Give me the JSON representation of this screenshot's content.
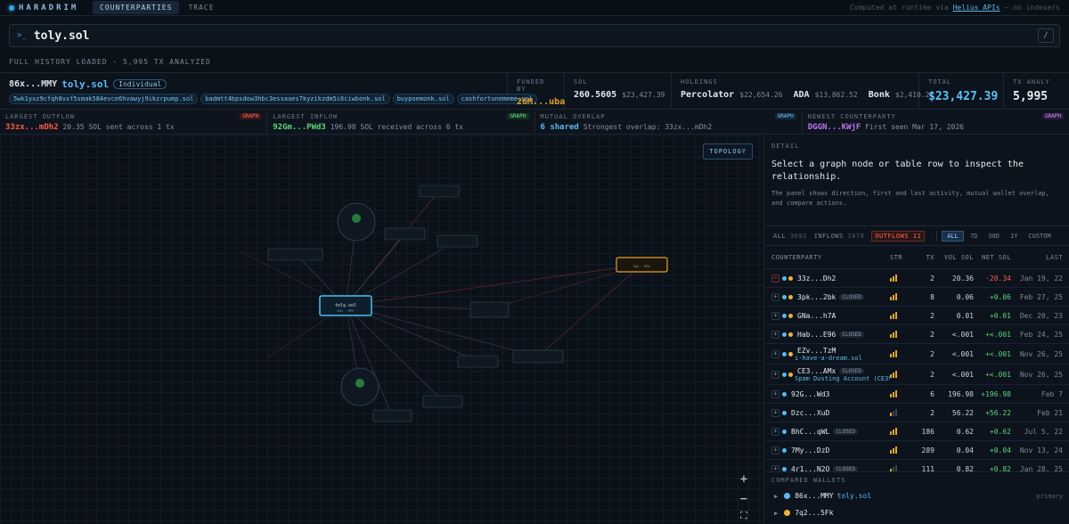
{
  "app": {
    "brand": "HARADRIM",
    "tabs": [
      "COUNTERPARTIES",
      "TRACE"
    ],
    "computed_prefix": "Computed at runtime via",
    "computed_link": "Helius APIs",
    "computed_suffix": "— no indexers"
  },
  "search": {
    "prompt": ">_",
    "query": "toly.sol",
    "shortcut": "/"
  },
  "status": "FULL HISTORY LOADED · 5,995 TX ANALYZED",
  "wallet": {
    "address": "86x...MMY",
    "name": "toly.sol",
    "type": "Individual",
    "domains": [
      "5wk1yxz9cfqh8vxf5smak584evce6hvawyj9ikzrpump.sol",
      "badmtt4bpsdow3hbc3essaaes7kyzikzdm5i6ciwbonk.sol",
      "buypoemonk.sol",
      "cashfortunememe.sol"
    ]
  },
  "summary": {
    "funded_by_label": "FUNDED BY",
    "funded_by": "26M...uba",
    "sol_label": "SOL",
    "sol": "260.5605",
    "sol_usd": "$23,427.39",
    "holdings_label": "HOLDINGS",
    "holdings": [
      {
        "name": "Percolator",
        "value": "$22,654.26"
      },
      {
        "name": "ADA",
        "value": "$13,862.52"
      },
      {
        "name": "Bonk",
        "value": "$2,410.27"
      }
    ],
    "total_label": "TOTAL",
    "total": "$23,427.39",
    "tx_label": "TX ANALYZE",
    "tx": "5,995"
  },
  "cards": [
    {
      "label": "LARGEST OUTFLOW",
      "tag": "GRAPH",
      "main": "33zx...mDh2",
      "text": "20.35 SOL sent across 1 tx"
    },
    {
      "label": "LARGEST INFLOW",
      "tag": "GRAPH",
      "main": "92Gm...PWd3",
      "text": "196.98 SOL received across 6 tx"
    },
    {
      "label": "MUTUAL OVERLAP",
      "tag": "GRAPH",
      "main": "6 shared",
      "text": "Strongest overlap: 33zx...mDh2"
    },
    {
      "label": "NEWEST COUNTERPARTY",
      "tag": "GRAPH",
      "main": "DGGN...KWjF",
      "text": "First seen Mar 17, 2026"
    }
  ],
  "graph": {
    "topology_label": "TOPOLOGY",
    "zoom_in": "+",
    "zoom_out": "−",
    "fit": "⛶",
    "center": {
      "title": "toly.sol",
      "sub": "86x...MMY"
    },
    "highlight": {
      "title": "7q2...5Fk"
    }
  },
  "detail": {
    "label": "DETAIL",
    "title": "Select a graph node or table row to inspect the relationship.",
    "desc": "The panel shows direction, first and last activity, mutual wallet overlap, and compare actions.",
    "filters": [
      {
        "label": "ALL",
        "count": "3092"
      },
      {
        "label": "INFLOWS",
        "count": "1879"
      },
      {
        "label": "OUTFLOWS",
        "count": "11"
      }
    ],
    "ranges": [
      "ALL",
      "7D",
      "30D",
      "1Y",
      "CUSTOM"
    ],
    "columns": [
      "COUNTERPARTY",
      "STR",
      "TX",
      "VOL SOL",
      "NET SOL",
      "LAST"
    ],
    "rows": [
      {
        "cp": "33z...Dh2",
        "sub": "",
        "closed": "",
        "dots": "by",
        "str": 3,
        "tx": "2",
        "vol": "20.36",
        "net": "-20.34",
        "last": "Jan 19, 22",
        "neg": true
      },
      {
        "cp": "3pk...2bk",
        "sub": "",
        "closed": "CLOSED",
        "dots": "by",
        "str": 3,
        "tx": "8",
        "vol": "0.06",
        "net": "+0.06",
        "last": "Feb 27, 25",
        "neg": false
      },
      {
        "cp": "GNa...h7A",
        "sub": "",
        "closed": "",
        "dots": "by",
        "str": 3,
        "tx": "2",
        "vol": "0.01",
        "net": "+0.01",
        "last": "Dec 20, 23",
        "neg": false
      },
      {
        "cp": "Hab...E96",
        "sub": "",
        "closed": "CLOSED",
        "dots": "by",
        "str": 3,
        "tx": "2",
        "vol": "<.001",
        "net": "+<.001",
        "last": "Feb 24, 25",
        "neg": false
      },
      {
        "cp": "EZv...TzM",
        "sub": "i-have-a-dream.sol",
        "closed": "",
        "dots": "by",
        "str": 3,
        "tx": "2",
        "vol": "<.001",
        "net": "+<.001",
        "last": "Nov 26, 25",
        "neg": false
      },
      {
        "cp": "CE3...AMx",
        "sub": "Spam Dusting Account (CE3V43)",
        "closed": "CLOSED",
        "dots": "by",
        "str": 3,
        "tx": "2",
        "vol": "<.001",
        "net": "+<.001",
        "last": "Nov 26, 25",
        "neg": false
      },
      {
        "cp": "92G...Wd3",
        "sub": "",
        "closed": "",
        "dots": "b",
        "str": 3,
        "tx": "6",
        "vol": "196.98",
        "net": "+196.98",
        "last": "Feb 7",
        "neg": false
      },
      {
        "cp": "Dzc...XuD",
        "sub": "",
        "closed": "",
        "dots": "b",
        "str": 1,
        "tx": "2",
        "vol": "56.22",
        "net": "+56.22",
        "last": "Feb 21",
        "neg": false
      },
      {
        "cp": "BhC...qWL",
        "sub": "",
        "closed": "CLOSED",
        "dots": "b",
        "str": 3,
        "tx": "186",
        "vol": "0.62",
        "net": "+0.62",
        "last": "Jul 5, 22",
        "neg": false
      },
      {
        "cp": "7My...DzD",
        "sub": "",
        "closed": "",
        "dots": "b",
        "str": 3,
        "tx": "289",
        "vol": "0.04",
        "net": "+0.04",
        "last": "Nov 13, 24",
        "neg": false
      },
      {
        "cp": "4r1...N2Q",
        "sub": "",
        "closed": "CLOSED",
        "dots": "b",
        "str": 1,
        "tx": "111",
        "vol": "0.82",
        "net": "+0.82",
        "last": "Jan 28, 25",
        "neg": false
      }
    ]
  },
  "compared": {
    "label": "COMPARED WALLETS",
    "wallets": [
      {
        "addr": "86x...MMY",
        "name": "toly.sol",
        "tag": "primary",
        "color": "#57b9f0"
      },
      {
        "addr": "7q2...5Fk",
        "name": "",
        "tag": "",
        "color": "#f0b23c"
      }
    ]
  },
  "colors": {
    "accent": "#5cc2f6",
    "outflow": "#ff5a48",
    "inflow": "#59d67a",
    "highlight": "#f0b23c"
  }
}
